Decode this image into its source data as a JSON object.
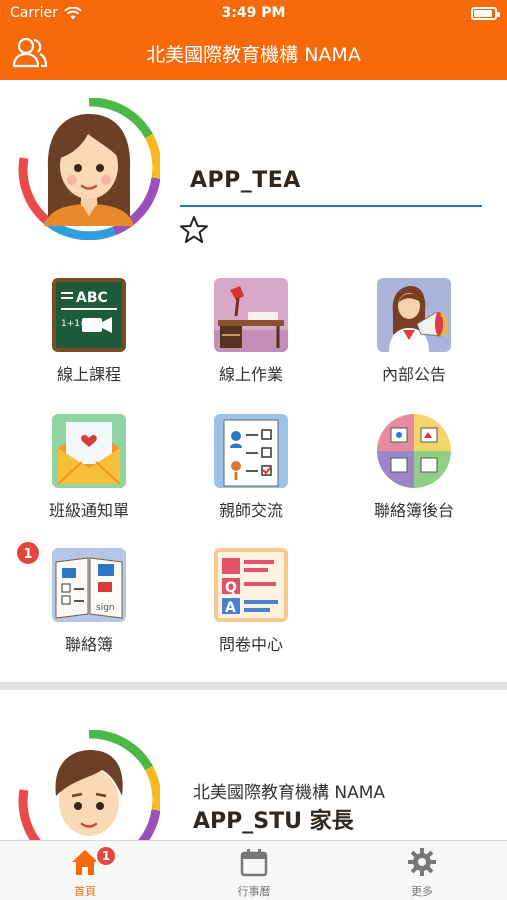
{
  "status_bar": {
    "carrier": "Carrier",
    "time": "3:49 PM"
  },
  "header": {
    "title": "北美國際教育機構 NAMA"
  },
  "profile": {
    "name": "APP_TEA"
  },
  "menu": {
    "items": [
      {
        "label": "線上課程",
        "icon": "online-course-icon"
      },
      {
        "label": "線上作業",
        "icon": "online-homework-icon"
      },
      {
        "label": "內部公告",
        "icon": "internal-announcement-icon"
      },
      {
        "label": "班級通知單",
        "icon": "class-notice-icon"
      },
      {
        "label": "親師交流",
        "icon": "parent-teacher-icon"
      },
      {
        "label": "聯絡簿後台",
        "icon": "contact-book-admin-icon"
      },
      {
        "label": "聯絡簿",
        "icon": "contact-book-icon",
        "badge": "1"
      },
      {
        "label": "問卷中心",
        "icon": "survey-center-icon"
      }
    ]
  },
  "second_card": {
    "org": "北美國際教育機構 NAMA",
    "name": "APP_STU 家長"
  },
  "tabbar": {
    "tabs": [
      {
        "label": "首頁",
        "icon": "home-icon",
        "badge": "1",
        "active": true
      },
      {
        "label": "行事曆",
        "icon": "calendar-icon"
      },
      {
        "label": "更多",
        "icon": "gear-icon"
      }
    ]
  },
  "colors": {
    "brand": "#f76a0c",
    "badge": "#e5463d",
    "underline": "#2b73b8"
  }
}
